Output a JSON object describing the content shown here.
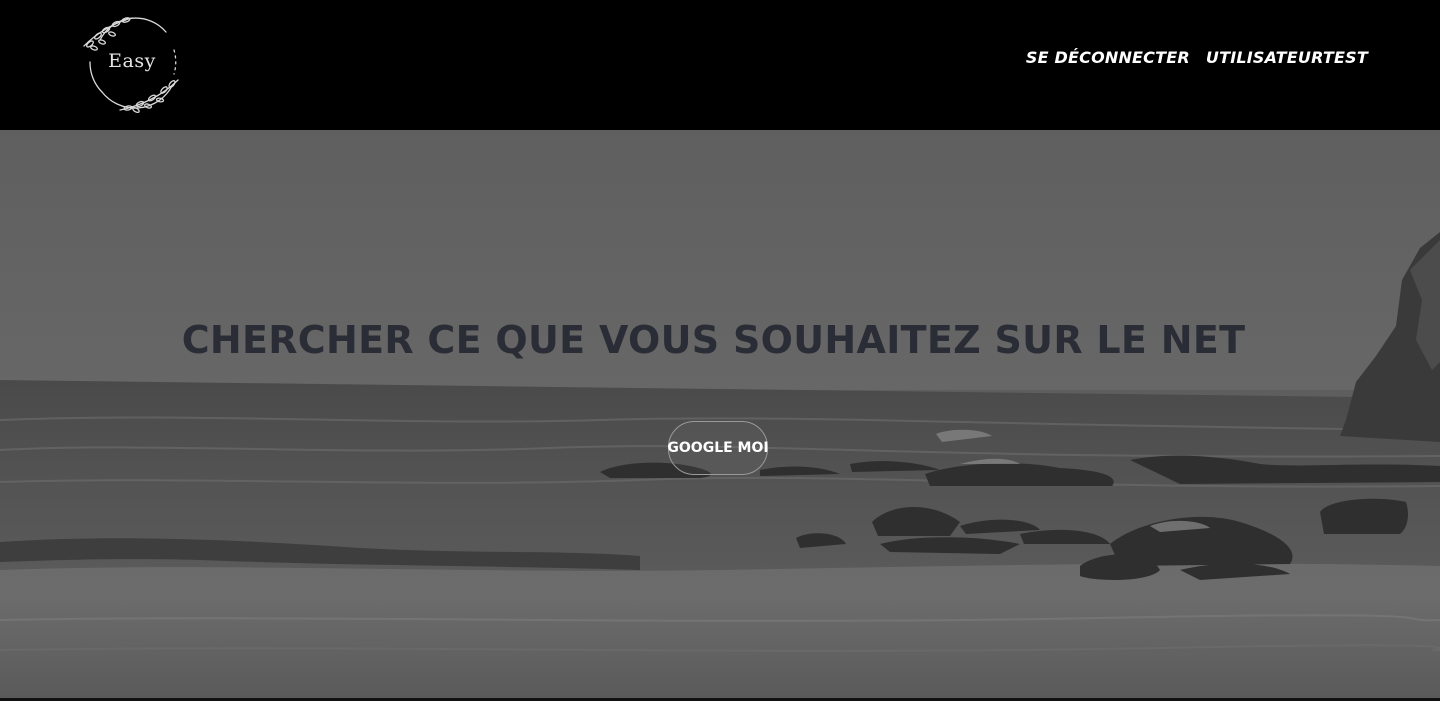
{
  "header": {
    "logo_text": "Easy",
    "nav": [
      {
        "label": "SE DÉCONNECTER"
      },
      {
        "label": "UTILISATEURTEST"
      }
    ]
  },
  "hero": {
    "headline": "CHERCHER CE QUE VOUS SOUHAITEZ SUR LE NET",
    "cta_label": "GOOGLE MOI"
  },
  "colors": {
    "header_bg": "#000000",
    "headline": "#2a2d35",
    "cta_text": "#ffffff"
  }
}
